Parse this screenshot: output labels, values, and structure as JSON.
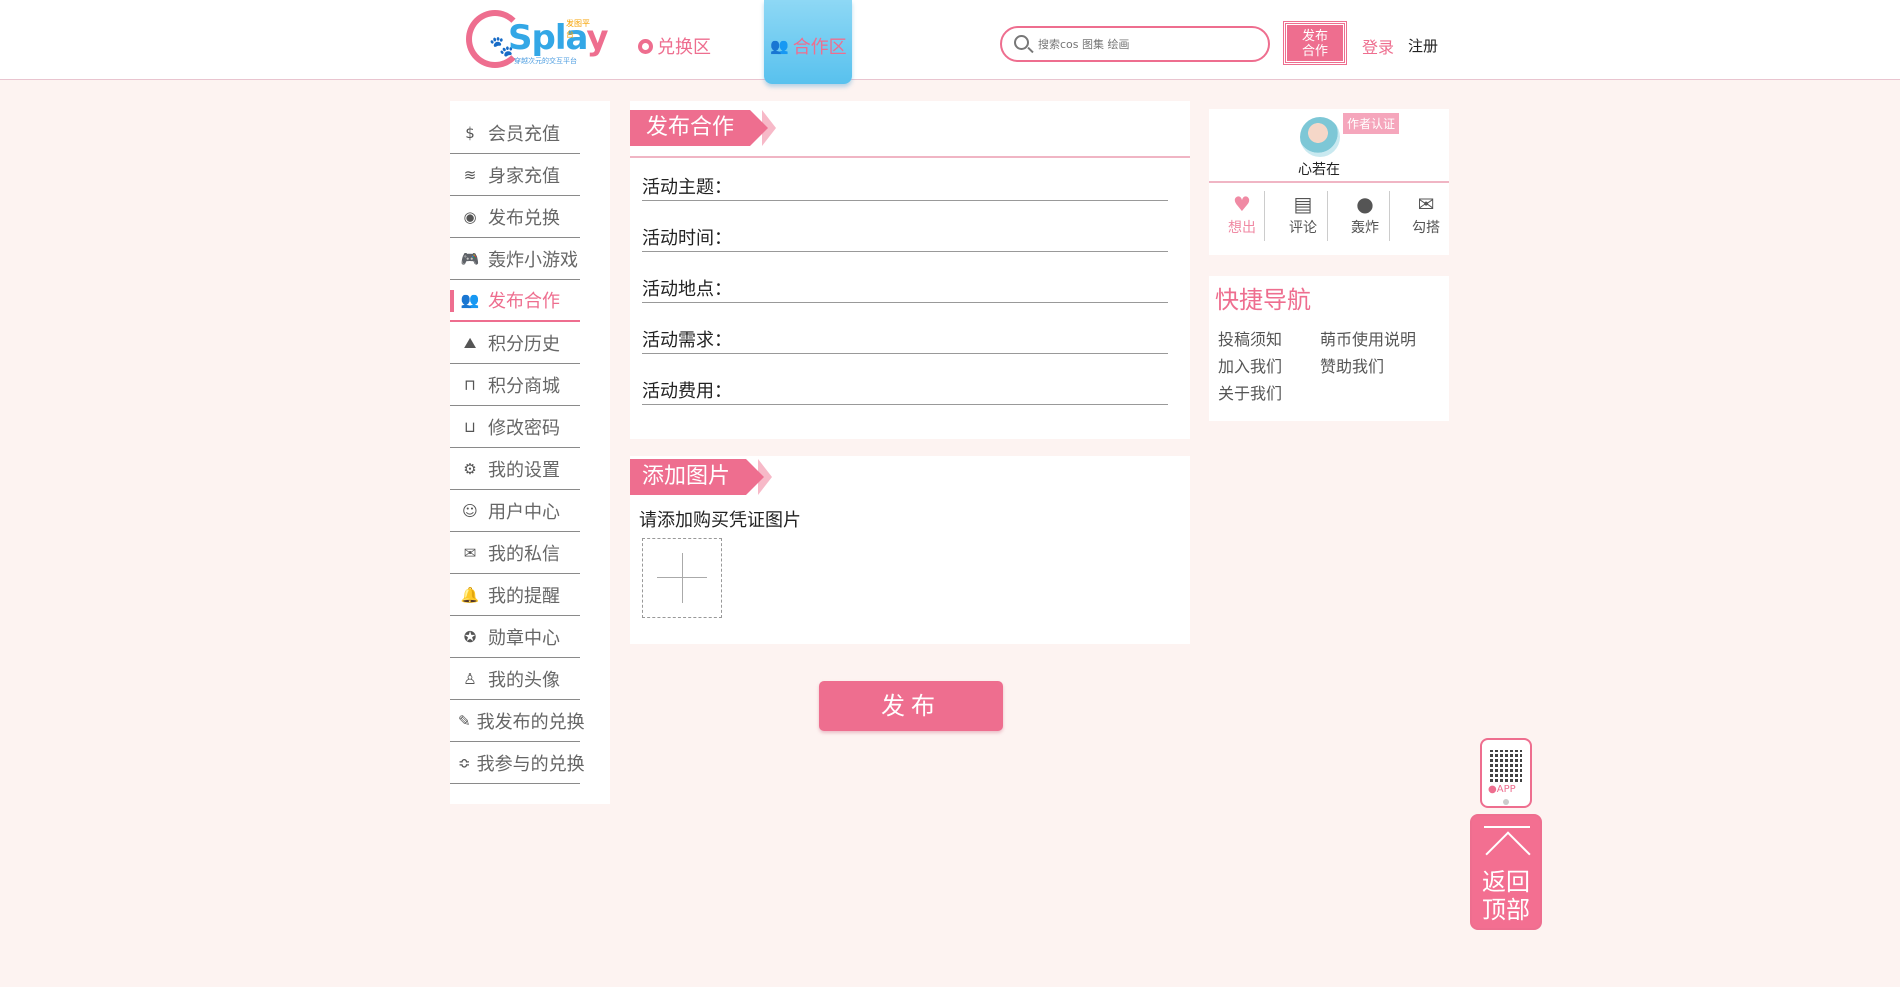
{
  "header": {
    "logo": {
      "word_c": "C",
      "word": "S",
      "word_pl": "pla",
      "word_y": "y",
      "flag": "发图平台",
      "tagline": "穿越次元的交互平台"
    },
    "nav": [
      {
        "label": "兑换区",
        "icon": "ring-icon"
      },
      {
        "label": "合作区",
        "icon": "people-icon",
        "active": true
      }
    ],
    "search": {
      "placeholder": "搜索cos 图集 绘画"
    },
    "publish_line1": "发布",
    "publish_line2": "合作",
    "login": "登录",
    "register": "注册"
  },
  "sidebar": {
    "items": [
      {
        "label": "会员充值",
        "icon": "dollar-icon"
      },
      {
        "label": "身家充值",
        "icon": "coins-icon"
      },
      {
        "label": "发布兑换",
        "icon": "ring-icon"
      },
      {
        "label": "轰炸小游戏",
        "icon": "gamepad-icon"
      },
      {
        "label": "发布合作",
        "icon": "people-icon",
        "active": true
      },
      {
        "label": "积分历史",
        "icon": "shoe-icon"
      },
      {
        "label": "积分商城",
        "icon": "bag-icon"
      },
      {
        "label": "修改密码",
        "icon": "lock-icon"
      },
      {
        "label": "我的设置",
        "icon": "gear-icon"
      },
      {
        "label": "用户中心",
        "icon": "user-settings-icon"
      },
      {
        "label": "我的私信",
        "icon": "envelope-icon"
      },
      {
        "label": "我的提醒",
        "icon": "bell-icon"
      },
      {
        "label": "勋章中心",
        "icon": "medal-icon"
      },
      {
        "label": "我的头像",
        "icon": "person-icon"
      },
      {
        "label": "我发布的兑换",
        "icon": "edit-icon"
      },
      {
        "label": "我参与的兑换",
        "icon": "layers-icon"
      }
    ]
  },
  "form": {
    "title": "发布合作",
    "fields": [
      {
        "label": "活动主题：",
        "value": ""
      },
      {
        "label": "活动时间：",
        "value": ""
      },
      {
        "label": "活动地点：",
        "value": ""
      },
      {
        "label": "活动需求：",
        "value": ""
      },
      {
        "label": "活动费用：",
        "value": ""
      }
    ]
  },
  "images": {
    "title": "添加图片",
    "hint": "请添加购买凭证图片"
  },
  "submit_label": "发布",
  "profile": {
    "badge": "作者认证",
    "name": "心若在",
    "actions": [
      {
        "label": "想出",
        "icon": "heart-icon",
        "active": true
      },
      {
        "label": "评论",
        "icon": "comment-icon"
      },
      {
        "label": "轰炸",
        "icon": "bomb-icon"
      },
      {
        "label": "勾搭",
        "icon": "mail-icon"
      }
    ]
  },
  "quick_nav": {
    "title": "快捷导航",
    "links": [
      "投稿须知",
      "萌币使用说明",
      "加入我们",
      "赞助我们",
      "关于我们"
    ]
  },
  "app_badge": "APP",
  "back_to_top": {
    "line1": "返回",
    "line2": "顶部"
  },
  "colors": {
    "accent": "#ee6e8f",
    "nav_active": "#58c1ee",
    "background": "#fdf3f1"
  }
}
